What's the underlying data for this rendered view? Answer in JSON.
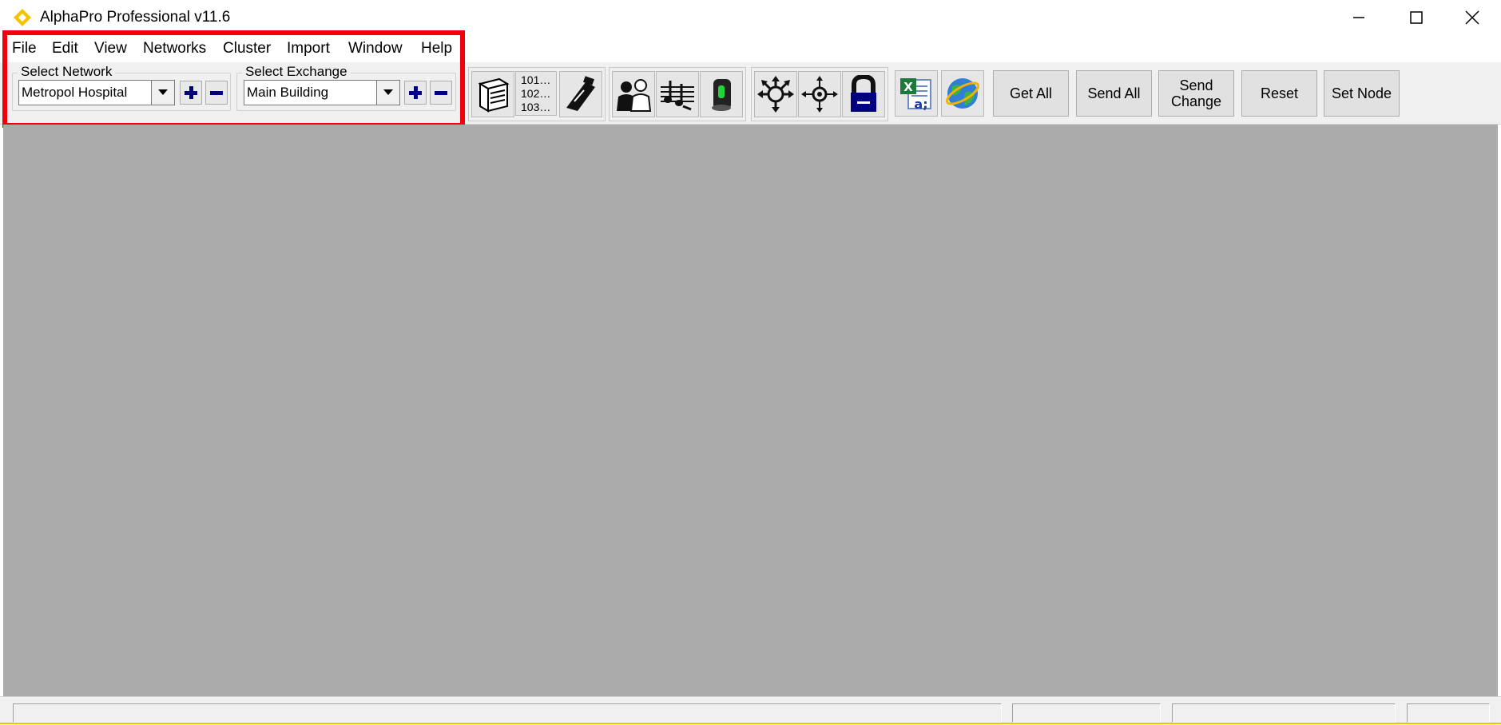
{
  "window": {
    "title": "AlphaPro Professional v11.6"
  },
  "menu": [
    "File",
    "Edit",
    "View",
    "Networks",
    "Cluster",
    "Import",
    "Window",
    "Help"
  ],
  "network": {
    "label": "Select Network",
    "value": "Metropol Hospital"
  },
  "exchange": {
    "label": "Select Exchange",
    "value": "Main Building"
  },
  "numbering": {
    "line1": "101…",
    "line2": "102…",
    "line3": "103…"
  },
  "toolbar_icons": [
    "cabinet-icon",
    "numbering-icon",
    "phone-icon",
    "users-icon",
    "music-on-hold-icon",
    "device-icon",
    "expand-arrows-icon",
    "crosshair-arrows-icon",
    "lock-icon",
    "excel-icon",
    "globe-icon"
  ],
  "buttons": {
    "get_all": "Get All",
    "send_all": "Send All",
    "send_change_1": "Send",
    "send_change_2": "Change",
    "reset": "Reset",
    "set_node": "Set Node"
  },
  "colors": {
    "highlight": "#f2000e",
    "workspace": "#ababab",
    "accent": "#000080"
  }
}
